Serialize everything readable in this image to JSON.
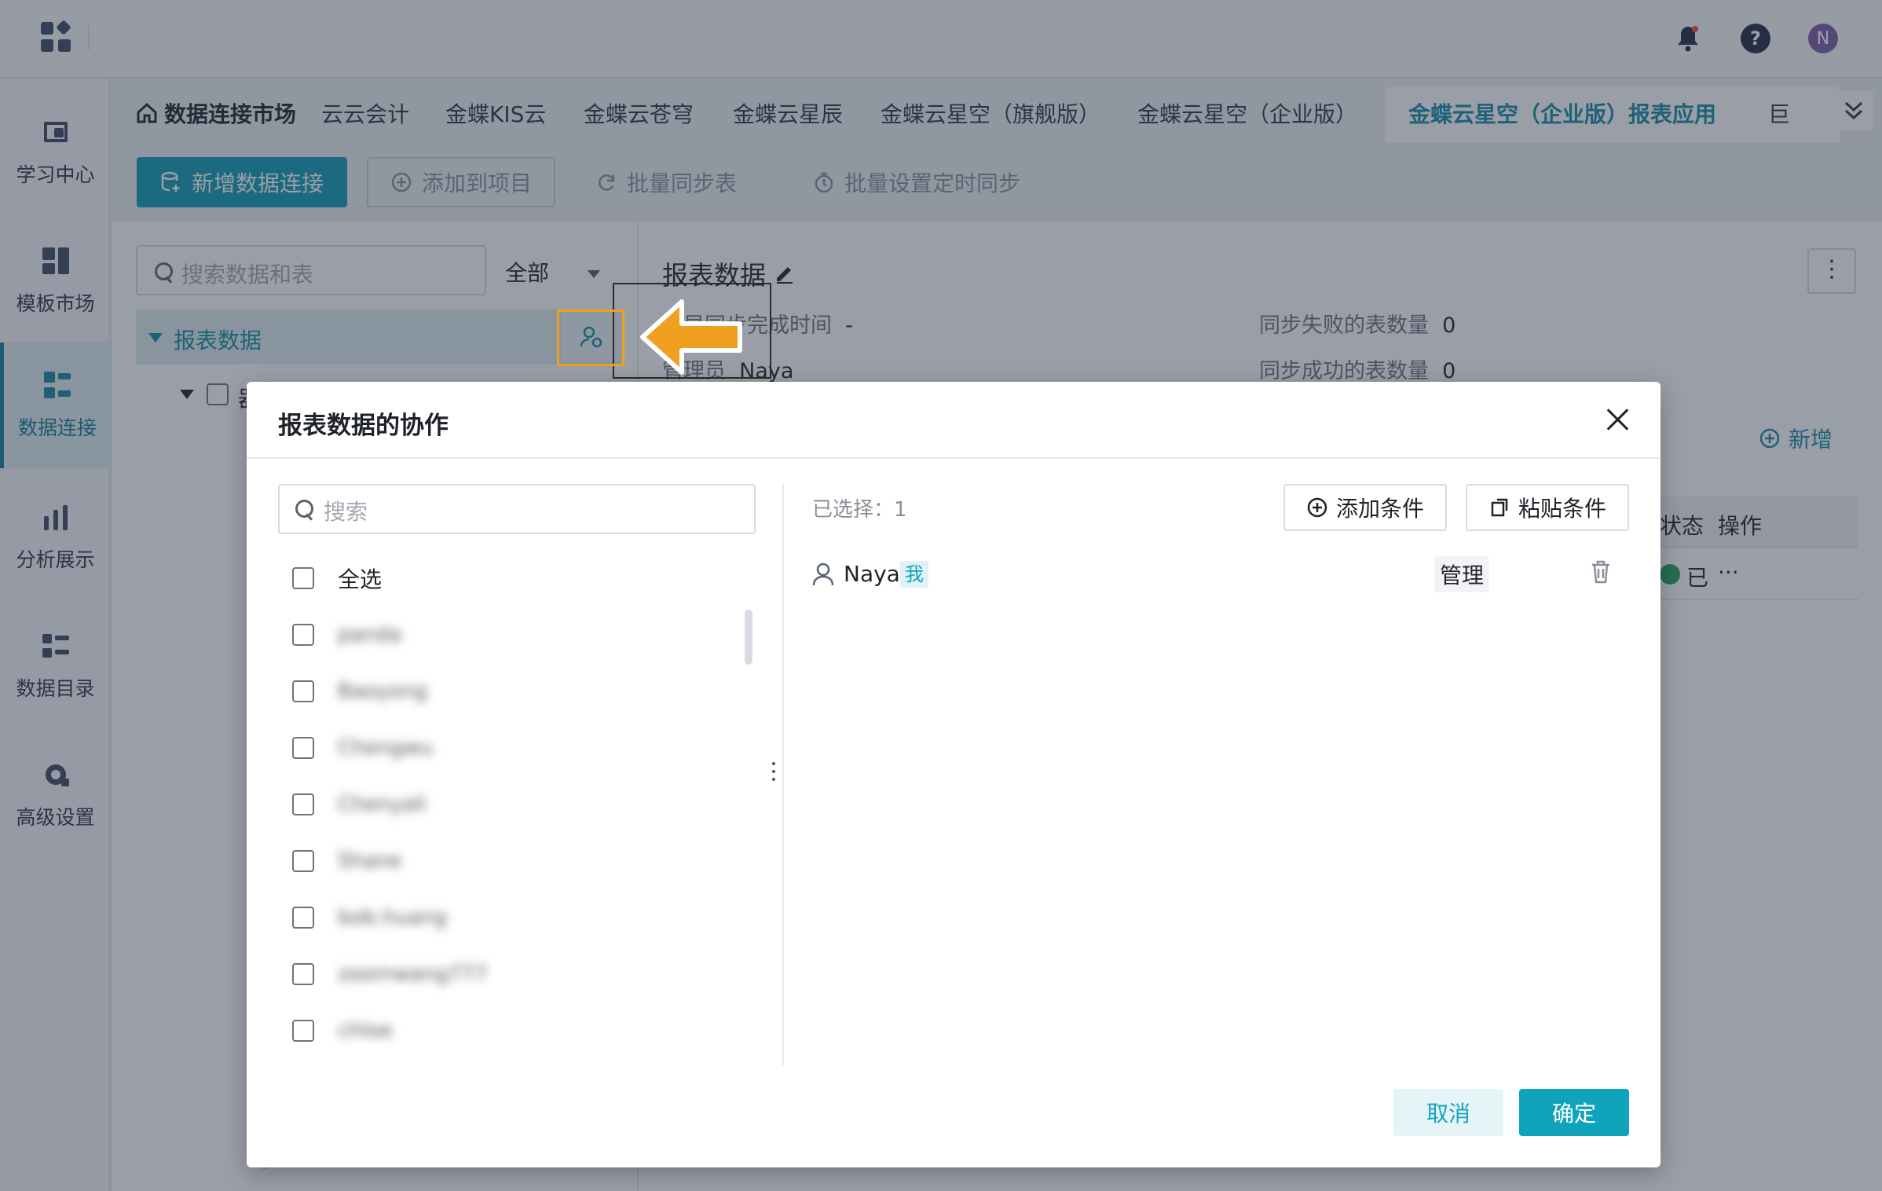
{
  "topbar": {
    "icons": [
      "apps-grid-icon",
      "bell-icon",
      "help-icon",
      "avatar"
    ],
    "avatar_letter": "N",
    "avatar_color": "#7b5aa6",
    "help_color": "#1f2a44",
    "bell_color": "#1f2a44"
  },
  "sidebar": {
    "items": [
      {
        "label": "学习中心",
        "icon": "book-icon"
      },
      {
        "label": "模板市场",
        "icon": "template-icon"
      },
      {
        "label": "数据连接",
        "icon": "data-connect-icon",
        "active": true
      },
      {
        "label": "分析展示",
        "icon": "chart-icon"
      },
      {
        "label": "数据目录",
        "icon": "catalog-icon"
      },
      {
        "label": "高级设置",
        "icon": "gear-icon"
      }
    ]
  },
  "tabs": {
    "home_label": "数据连接市场",
    "items": [
      "云云会计",
      "金蝶KIS云",
      "金蝶云苍穹",
      "金蝶云星辰",
      "金蝶云星空（旗舰版）",
      "金蝶云星空（企业版）",
      "金蝶云星空（企业版）报表应用",
      "巨"
    ],
    "active_index": 6
  },
  "toolbar": {
    "new_connection": "新增数据连接",
    "add_to_project": "添加到项目",
    "batch_sync": "批量同步表",
    "batch_schedule": "批量设置定时同步"
  },
  "left_panel": {
    "search_placeholder": "搜索数据和表",
    "filter_label": "全部",
    "tree_root": "报表数据",
    "tree_child": "器"
  },
  "detail": {
    "title": "报表数据",
    "last_sync_label": "最早同步完成时间",
    "last_sync_value": "-",
    "admin_label": "管理员",
    "admin_value": "Naya",
    "fail_label": "同步失败的表数量",
    "fail_value": "0",
    "success_label": "同步成功的表数量",
    "success_value": "0",
    "add_new": "新增",
    "col_status": "状态",
    "col_action": "操作",
    "row_status": "已",
    "row_action": "···"
  },
  "dialog": {
    "title": "报表数据的协作",
    "search_placeholder": "搜索",
    "select_all": "全选",
    "users": [
      "panda",
      "Baoyong",
      "Chengwu",
      "Chenyali",
      "Shane",
      "bob.huang",
      "zoomwang777",
      "chloe"
    ],
    "selected_label": "已选择：",
    "selected_count": "1",
    "add_condition": "添加条件",
    "paste_condition": "粘贴条件",
    "selected_user": "Naya",
    "me_tag": "我",
    "role": "管理",
    "cancel": "取消",
    "confirm": "确定"
  },
  "colors": {
    "accent": "#13a3bd",
    "primary_button": "#0f9bb5",
    "active_tab": "#158aa8",
    "highlight": "#f0a020",
    "success": "#22a35a"
  }
}
